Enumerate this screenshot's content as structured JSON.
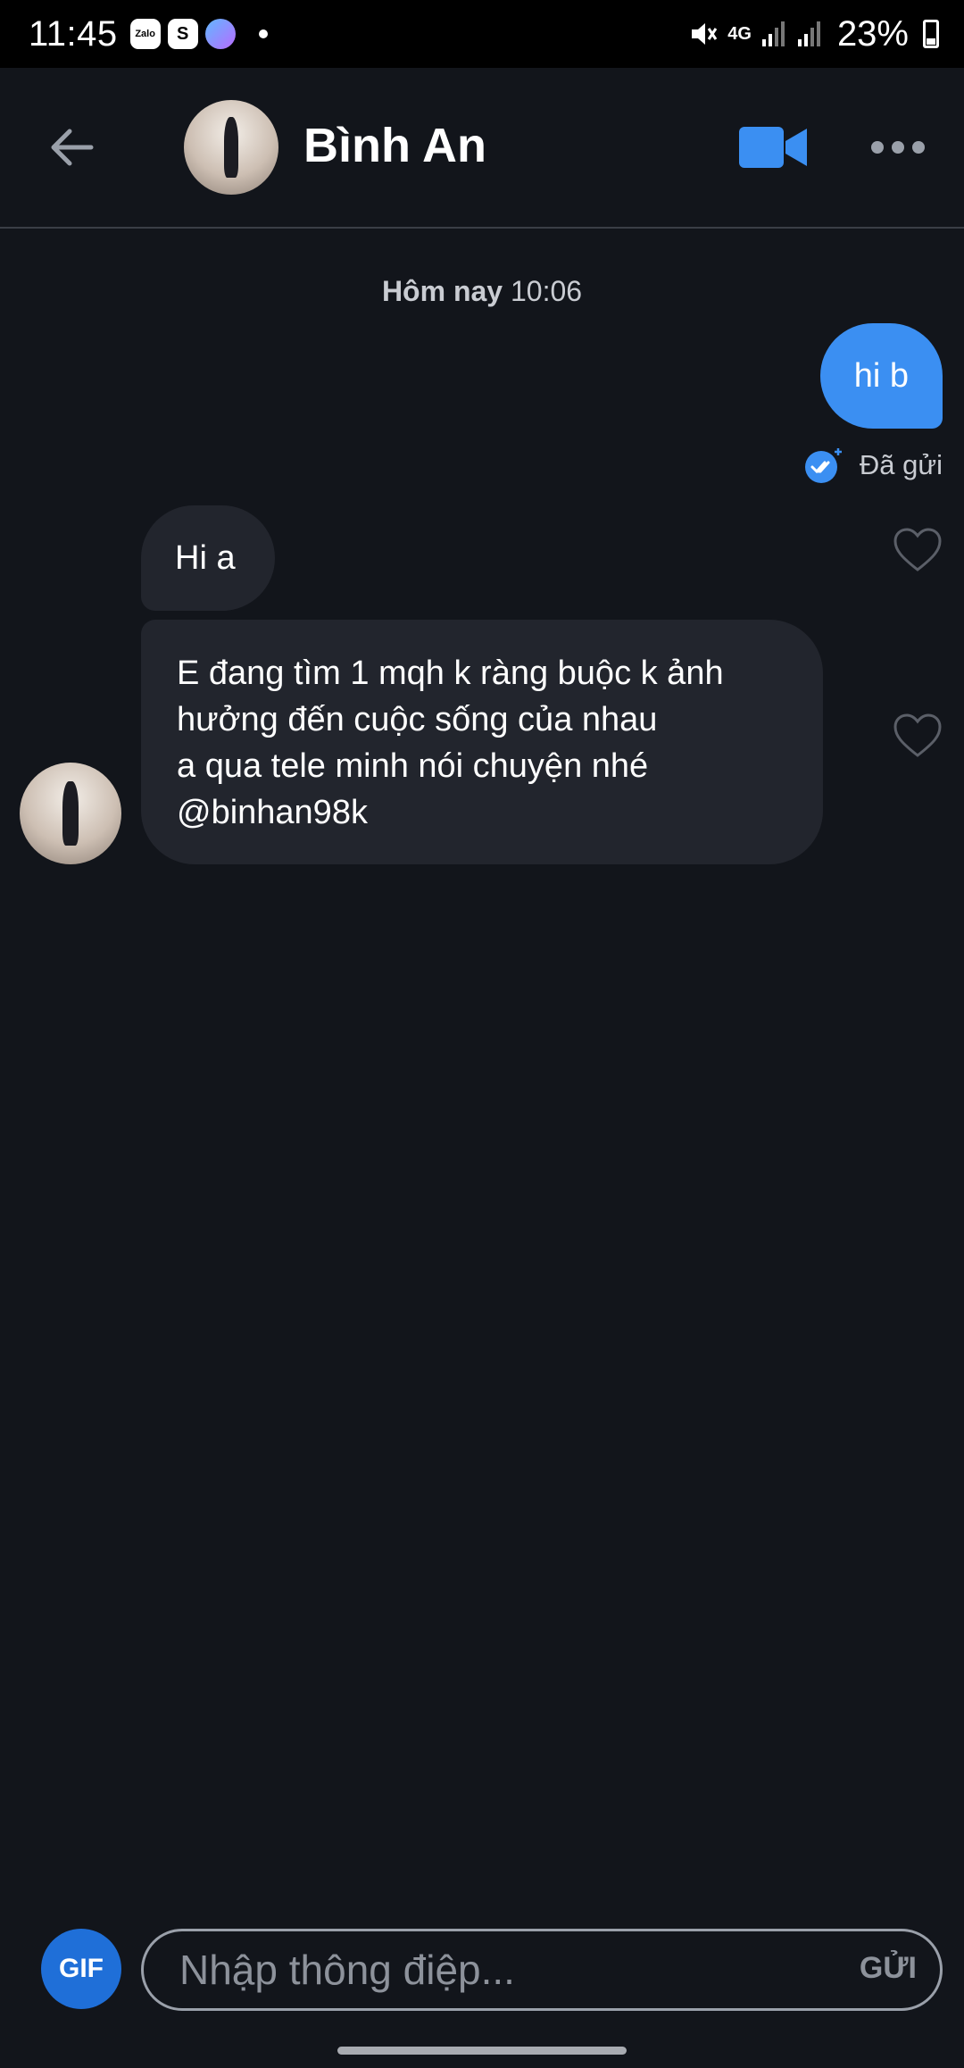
{
  "status_bar": {
    "time": "11:45",
    "apps": [
      "Zalo",
      "S"
    ],
    "network": "4G",
    "battery": "23%"
  },
  "header": {
    "contact_name": "Bình An",
    "icons": {
      "back": "arrow-left-icon",
      "video": "video-camera-icon",
      "more": "more-horizontal-icon"
    }
  },
  "chat": {
    "timestamp_day": "Hôm nay",
    "timestamp_time": "10:06",
    "messages": [
      {
        "direction": "outgoing",
        "text": "hi b",
        "status": "Đã gửi"
      },
      {
        "direction": "incoming",
        "text": "Hi a"
      },
      {
        "direction": "incoming",
        "lines": [
          "E đang tìm 1 mqh k ràng buộc k ảnh",
          "hưởng đến cuộc sống của nhau",
          "a qua tele minh nói chuyện nhé",
          "@binhan98k"
        ]
      }
    ]
  },
  "composer": {
    "gif_label": "GIF",
    "placeholder": "Nhập thông điệp...",
    "send_label": "GỬI"
  },
  "colors": {
    "background": "#12151b",
    "outgoing_bubble": "#3b8ff2",
    "incoming_bubble": "#22252d",
    "accent": "#3b8ff2"
  }
}
